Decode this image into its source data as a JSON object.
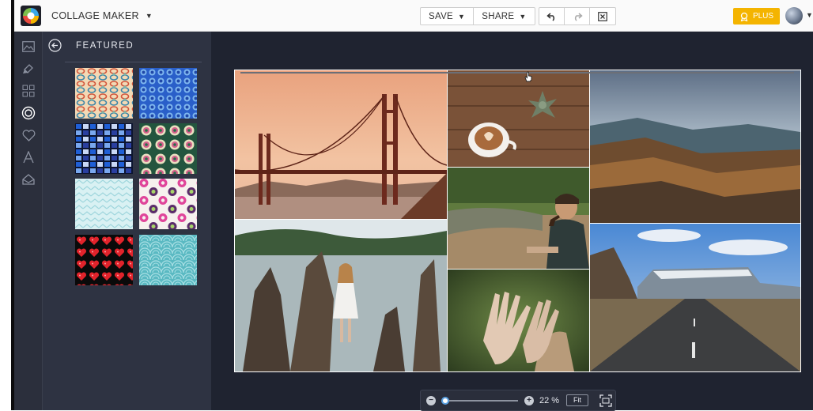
{
  "header": {
    "app_title": "COLLAGE MAKER",
    "save_label": "SAVE",
    "share_label": "SHARE",
    "plus_label": "PLUS"
  },
  "sidebar": {
    "icons": [
      "layout-icon",
      "background-icon",
      "grid-icon",
      "stickers-icon",
      "heart-icon",
      "text-icon",
      "textures-icon"
    ],
    "active_index": 3
  },
  "panel": {
    "title": "FEATURED",
    "patterns": [
      "retro-links-peach",
      "blue-polka-dots",
      "blue-mosaic-squares",
      "green-circles",
      "mint-chevron",
      "pink-polka-dots",
      "red-hearts",
      "teal-waves"
    ]
  },
  "canvas": {
    "photos": [
      "golden-gate-bridge",
      "latte-and-succulent",
      "mountain-sunset",
      "girl-in-lake",
      "man-with-pipe",
      "hands-over-face",
      "road-to-mountain"
    ]
  },
  "zoom": {
    "value": "22 %",
    "level": 0.04,
    "fit_label": "Fit"
  },
  "colors": {
    "accent": "#f4b400",
    "panel_bg": "#2e3342",
    "workspace_bg": "#1f2330"
  }
}
